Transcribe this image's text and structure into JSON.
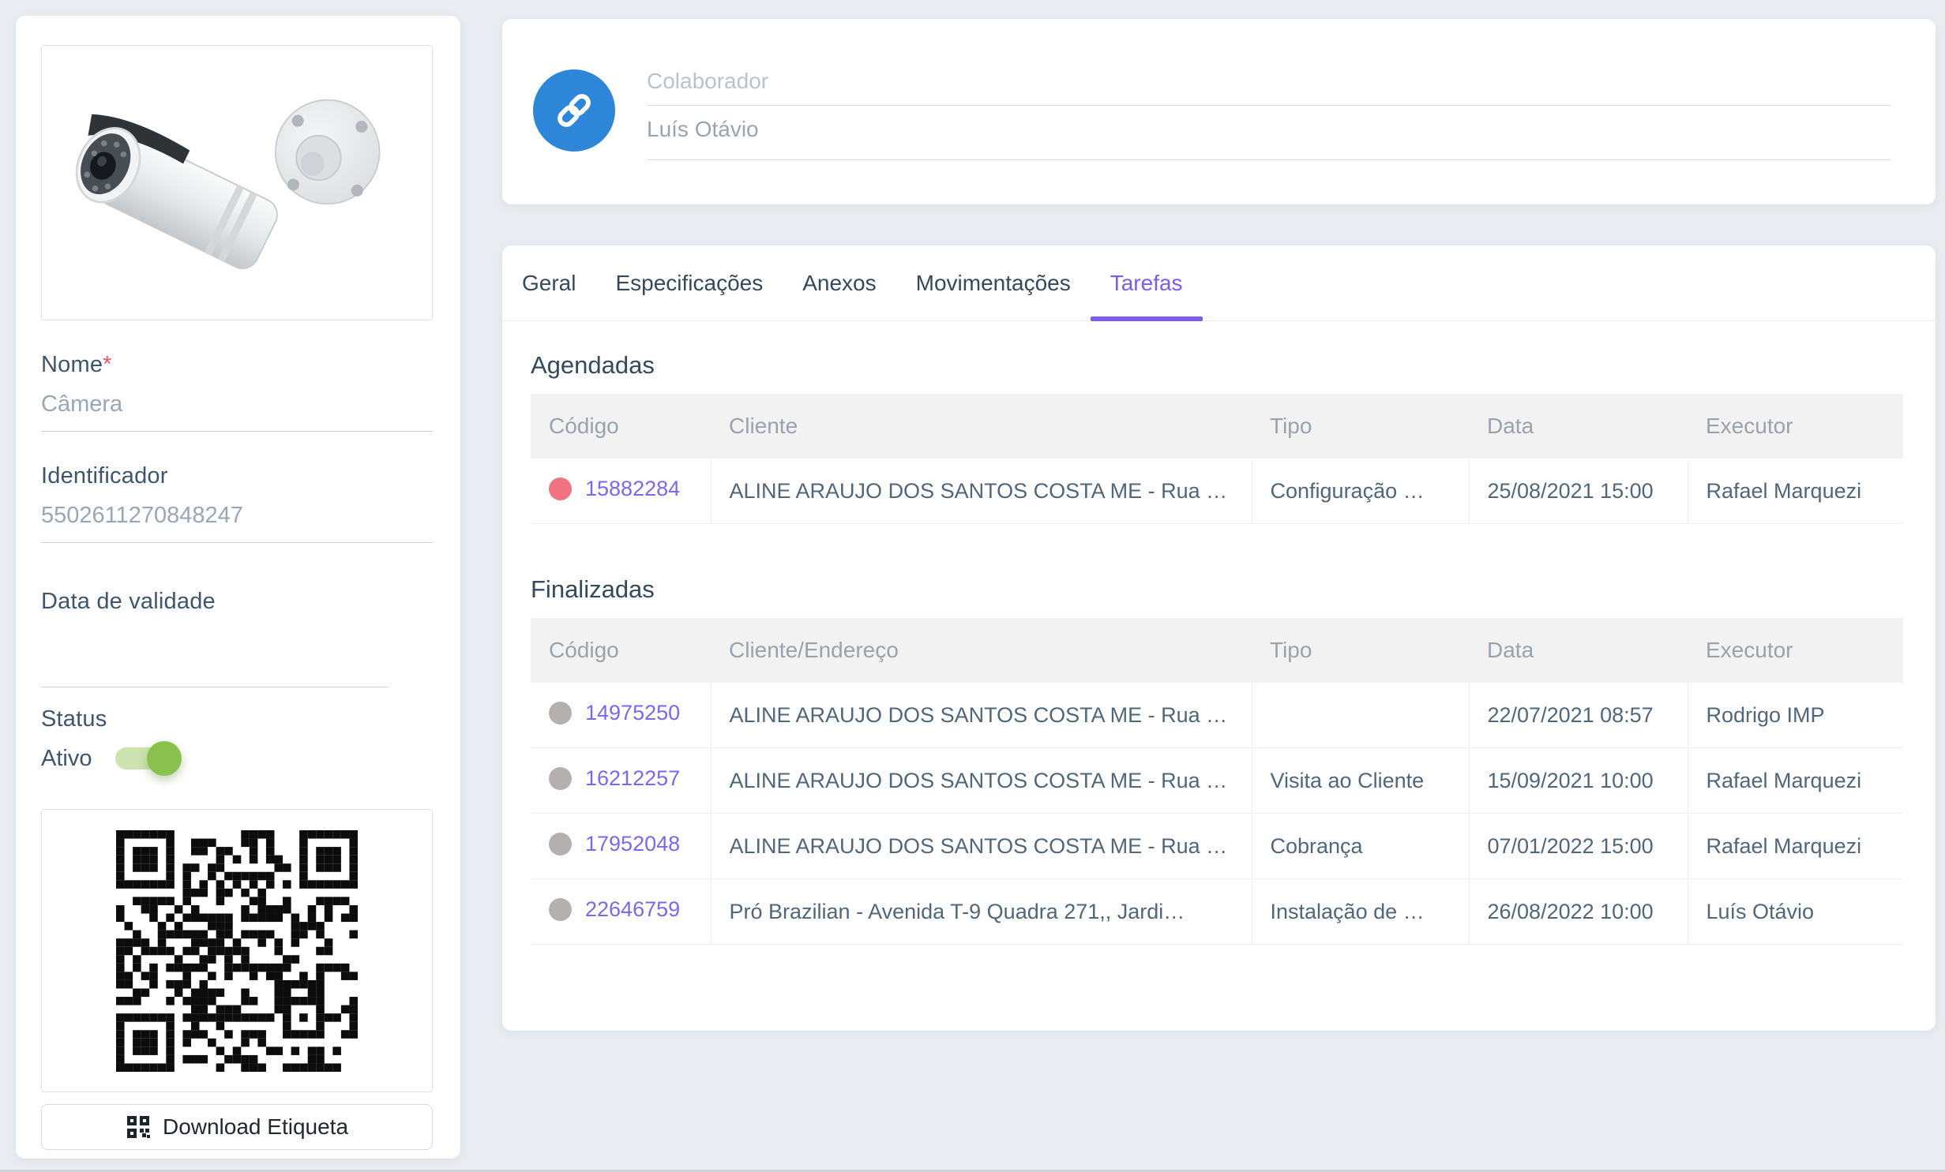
{
  "sidebar": {
    "image_alt": "Câmera",
    "fields": [
      {
        "label": "Nome",
        "required_mark": "*",
        "value": "Câmera"
      },
      {
        "label": "Identificador",
        "required_mark": "",
        "value": "5502611270848247"
      },
      {
        "label": "Data de validade",
        "required_mark": "",
        "value": ""
      }
    ],
    "status": {
      "label": "Status",
      "state_label": "Ativo",
      "on": true
    },
    "download_button_label": "Download Etiqueta"
  },
  "collaborator": {
    "label": "Colaborador",
    "value": "Luís Otávio"
  },
  "tabs": [
    {
      "label": "Geral",
      "active": false
    },
    {
      "label": "Especificações",
      "active": false
    },
    {
      "label": "Anexos",
      "active": false
    },
    {
      "label": "Movimentações",
      "active": false
    },
    {
      "label": "Tarefas",
      "active": true
    }
  ],
  "sections": [
    {
      "title": "Agendadas",
      "columns": [
        "Código",
        "Cliente",
        "Tipo",
        "Data",
        "Executor"
      ],
      "rows": [
        {
          "dot": "#f0737f",
          "code": "15882284",
          "client": "ALINE ARAUJO DOS SANTOS COSTA ME - Rua …",
          "tipo": "Configuração …",
          "data": "25/08/2021 15:00",
          "executor": "Rafael Marquezi"
        }
      ]
    },
    {
      "title": "Finalizadas",
      "columns": [
        "Código",
        "Cliente/Endereço",
        "Tipo",
        "Data",
        "Executor"
      ],
      "rows": [
        {
          "dot": "#b5b0b0",
          "code": "14975250",
          "client": "ALINE ARAUJO DOS SANTOS COSTA ME - Rua …",
          "tipo": "",
          "data": "22/07/2021 08:57",
          "executor": "Rodrigo IMP"
        },
        {
          "dot": "#b5b0b0",
          "code": "16212257",
          "client": "ALINE ARAUJO DOS SANTOS COSTA ME - Rua …",
          "tipo": "Visita ao Cliente",
          "data": "15/09/2021 10:00",
          "executor": "Rafael Marquezi"
        },
        {
          "dot": "#b5b0b0",
          "code": "17952048",
          "client": "ALINE ARAUJO DOS SANTOS COSTA ME - Rua …",
          "tipo": "Cobrança",
          "data": "07/01/2022 15:00",
          "executor": "Rafael Marquezi"
        },
        {
          "dot": "#b5b0b0",
          "code": "22646759",
          "client": "Pró Brazilian - Avenida T-9 Quadra 271,, Jardi…",
          "tipo": "Instalação de …",
          "data": "26/08/2022 10:00",
          "executor": "Luís Otávio"
        }
      ]
    }
  ],
  "colors": {
    "accent_purple": "#7c5cf0",
    "link_purple": "#7b68f0",
    "dot_red": "#f0737f",
    "dot_grey": "#b5b0b0",
    "toggle_green": "#8ac14e",
    "avatar_blue": "#2e86d9",
    "page_background": "#e9edf1"
  }
}
